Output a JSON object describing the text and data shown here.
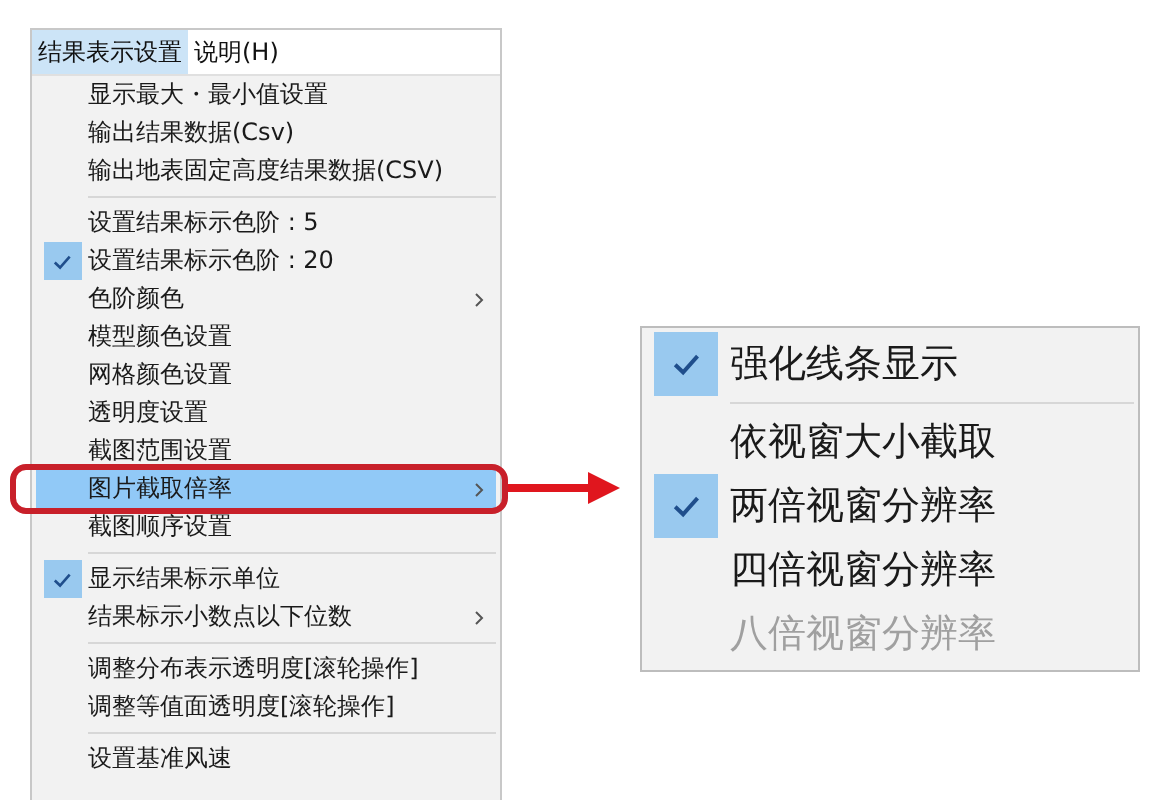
{
  "menubar": [
    {
      "label": "结果表示设置",
      "selected": true
    },
    {
      "label": "说明(H)",
      "selected": false
    }
  ],
  "menu": [
    {
      "kind": "item",
      "label": "显示最大・最小值设置",
      "checked": false,
      "submenu": false,
      "selected": false
    },
    {
      "kind": "item",
      "label": "输出结果数据(Csv)",
      "checked": false,
      "submenu": false,
      "selected": false
    },
    {
      "kind": "item",
      "label": "输出地表固定高度结果数据(CSV)",
      "checked": false,
      "submenu": false,
      "selected": false
    },
    {
      "kind": "separator"
    },
    {
      "kind": "item",
      "label": "设置结果标示色阶 : 5",
      "checked": false,
      "submenu": false,
      "selected": false
    },
    {
      "kind": "item",
      "label": "设置结果标示色阶 : 20",
      "checked": true,
      "submenu": false,
      "selected": false
    },
    {
      "kind": "item",
      "label": "色阶颜色",
      "checked": false,
      "submenu": true,
      "selected": false
    },
    {
      "kind": "item",
      "label": "模型颜色设置",
      "checked": false,
      "submenu": false,
      "selected": false
    },
    {
      "kind": "item",
      "label": "网格颜色设置",
      "checked": false,
      "submenu": false,
      "selected": false
    },
    {
      "kind": "item",
      "label": "透明度设置",
      "checked": false,
      "submenu": false,
      "selected": false
    },
    {
      "kind": "item",
      "label": "截图范围设置",
      "checked": false,
      "submenu": false,
      "selected": false
    },
    {
      "kind": "item",
      "label": "图片截取倍率",
      "checked": false,
      "submenu": true,
      "selected": true
    },
    {
      "kind": "item",
      "label": "截图顺序设置",
      "checked": false,
      "submenu": false,
      "selected": false
    },
    {
      "kind": "separator"
    },
    {
      "kind": "item",
      "label": "显示结果标示单位",
      "checked": true,
      "submenu": false,
      "selected": false
    },
    {
      "kind": "item",
      "label": "结果标示小数点以下位数",
      "checked": false,
      "submenu": true,
      "selected": false
    },
    {
      "kind": "separator"
    },
    {
      "kind": "item",
      "label": "调整分布表示透明度[滚轮操作]",
      "checked": false,
      "submenu": false,
      "selected": false
    },
    {
      "kind": "item",
      "label": "调整等值面透明度[滚轮操作]",
      "checked": false,
      "submenu": false,
      "selected": false
    },
    {
      "kind": "separator"
    },
    {
      "kind": "item",
      "label": "设置基准风速",
      "checked": false,
      "submenu": false,
      "selected": false
    }
  ],
  "submenu": [
    {
      "kind": "item",
      "label": "强化线条显示",
      "checked": true,
      "disabled": false
    },
    {
      "kind": "separator"
    },
    {
      "kind": "item",
      "label": "依视窗大小截取",
      "checked": false,
      "disabled": false
    },
    {
      "kind": "item",
      "label": "两倍视窗分辨率",
      "checked": true,
      "disabled": false
    },
    {
      "kind": "item",
      "label": "四倍视窗分辨率",
      "checked": false,
      "disabled": false
    },
    {
      "kind": "item",
      "label": "八倍视窗分辨率",
      "checked": false,
      "disabled": true
    }
  ]
}
